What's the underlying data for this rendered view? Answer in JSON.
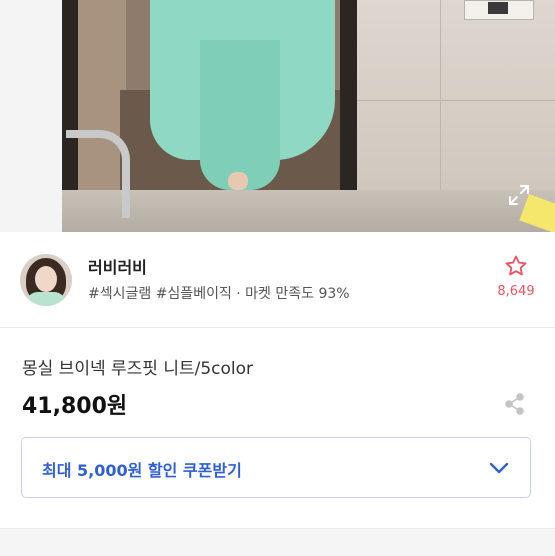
{
  "photo": {
    "expand_icon": "expand-arrows-icon"
  },
  "seller": {
    "name": "러비러비",
    "tags": "#섹시글램 #심플베이직 · 마켓 만족도 93%",
    "like_count": "8,649",
    "like_icon": "star-outline-icon",
    "accent_color": "#e65461"
  },
  "product": {
    "title": "몽실 브이넥 루즈핏 니트/5color",
    "price": "41,800원",
    "share_icon": "share-icon"
  },
  "coupon": {
    "label": "최대 5,000원 할인 쿠폰받기",
    "color": "#2f5fd2",
    "icon": "chevron-down-icon"
  }
}
